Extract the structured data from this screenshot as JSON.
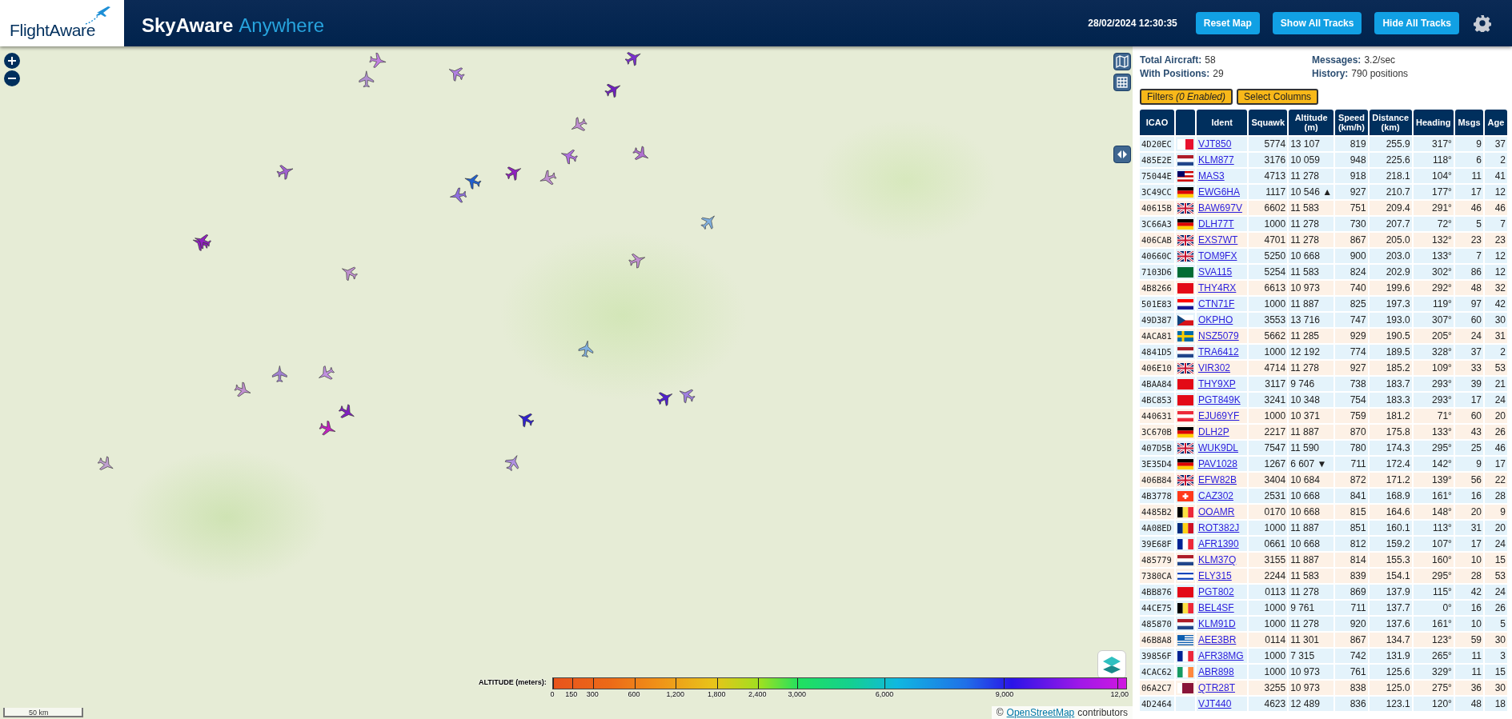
{
  "header": {
    "logo": "FlightAware",
    "title": "SkyAware",
    "subtitle": "Anywhere",
    "datetime": "28/02/2024 12:30:35",
    "buttons": [
      "Reset Map",
      "Show All Tracks",
      "Hide All Tracks"
    ]
  },
  "map": {
    "scale": "50 km",
    "attribution_prefix": "©",
    "attribution_link": "OpenStreetMap",
    "attribution_suffix": "contributors",
    "legend": {
      "title": "ALTITUDE (meters):",
      "ticks": [
        "0",
        "150",
        "300",
        "600",
        "1,200",
        "1,800",
        "2,400",
        "3,000",
        "6,000",
        "9,000",
        "12,00"
      ]
    }
  },
  "stats": [
    {
      "label": "Total Aircraft:",
      "value": "58"
    },
    {
      "label": "Messages:",
      "value": "3.2/sec"
    },
    {
      "label": "With Positions:",
      "value": "29"
    },
    {
      "label": "History:",
      "value": "790 positions"
    }
  ],
  "sidebar_buttons": [
    "Filters *(0 Enabled)*",
    "Select Columns"
  ],
  "table": {
    "columns": [
      "ICAO",
      "",
      "Ident",
      "Squawk",
      "Altitude (m)",
      "Speed (km/h)",
      "Distance (km)",
      "Heading",
      "Msgs",
      "Age"
    ],
    "rows": [
      {
        "icao": "4D20EC",
        "kind": "mt",
        "ident": "VJT850",
        "squawk": "5774",
        "altitude": "13 107",
        "speed": "819",
        "distance": "255.9",
        "heading": "317°",
        "msgs": "9",
        "age": "37",
        "color": "#e4f3fb"
      },
      {
        "icao": "485E2E",
        "kind": "nl",
        "ident": "KLM877",
        "squawk": "3176",
        "altitude": "10 059",
        "speed": "948",
        "distance": "225.6",
        "heading": "118°",
        "msgs": "6",
        "age": "2",
        "color": "#e4f3fb"
      },
      {
        "icao": "75044E",
        "kind": "my",
        "ident": "MAS3",
        "squawk": "4713",
        "altitude": "11 278",
        "speed": "918",
        "distance": "218.1",
        "heading": "104°",
        "msgs": "11",
        "age": "41",
        "color": "#e4f3fb"
      },
      {
        "icao": "3C49CC",
        "kind": "de",
        "ident": "EWG6HA",
        "squawk": "1117",
        "altitude": "10 546 ▲",
        "speed": "927",
        "distance": "210.7",
        "heading": "177°",
        "msgs": "17",
        "age": "12",
        "color": "#e4f3fb"
      },
      {
        "icao": "40615B",
        "kind": "gb",
        "ident": "BAW697V",
        "squawk": "6602",
        "altitude": "11 583",
        "speed": "751",
        "distance": "209.4",
        "heading": "291°",
        "msgs": "46",
        "age": "46",
        "color": "#fdf1e6"
      },
      {
        "icao": "3C66A3",
        "kind": "de",
        "ident": "DLH77T",
        "squawk": "1000",
        "altitude": "11 278",
        "speed": "730",
        "distance": "207.7",
        "heading": "72°",
        "msgs": "5",
        "age": "7",
        "color": "#e4f3fb"
      },
      {
        "icao": "406CAB",
        "kind": "gb",
        "ident": "EXS7WT",
        "squawk": "4701",
        "altitude": "11 278",
        "speed": "867",
        "distance": "205.0",
        "heading": "132°",
        "msgs": "23",
        "age": "23",
        "color": "#fdf1e6"
      },
      {
        "icao": "40660C",
        "kind": "gb",
        "ident": "TOM9FX",
        "squawk": "5250",
        "altitude": "10 668",
        "speed": "900",
        "distance": "203.0",
        "heading": "133°",
        "msgs": "7",
        "age": "12",
        "color": "#e4f3fb"
      },
      {
        "icao": "7103D6",
        "kind": "sa",
        "ident": "SVA115",
        "squawk": "5254",
        "altitude": "11 583",
        "speed": "824",
        "distance": "202.9",
        "heading": "302°",
        "msgs": "86",
        "age": "12",
        "color": "#e4f3fb"
      },
      {
        "icao": "4B8266",
        "kind": "tr",
        "ident": "THY4RX",
        "squawk": "6613",
        "altitude": "10 973",
        "speed": "740",
        "distance": "199.6",
        "heading": "292°",
        "msgs": "48",
        "age": "32",
        "color": "#fdf1e6"
      },
      {
        "icao": "501E83",
        "kind": "hr",
        "ident": "CTN71F",
        "squawk": "1000",
        "altitude": "11 887",
        "speed": "825",
        "distance": "197.3",
        "heading": "119°",
        "msgs": "97",
        "age": "42",
        "color": "#e4f3fb"
      },
      {
        "icao": "49D387",
        "kind": "cz",
        "ident": "OKPHO",
        "squawk": "3553",
        "altitude": "13 716",
        "speed": "747",
        "distance": "193.0",
        "heading": "307°",
        "msgs": "60",
        "age": "30",
        "color": "#e4f3fb"
      },
      {
        "icao": "4ACA81",
        "kind": "se",
        "ident": "NSZ5079",
        "squawk": "5662",
        "altitude": "11 285",
        "speed": "929",
        "distance": "190.5",
        "heading": "205°",
        "msgs": "24",
        "age": "31",
        "color": "#fdf1e6"
      },
      {
        "icao": "4841D5",
        "kind": "nl",
        "ident": "TRA6412",
        "squawk": "1000",
        "altitude": "12 192",
        "speed": "774",
        "distance": "189.5",
        "heading": "328°",
        "msgs": "37",
        "age": "2",
        "color": "#e4f3fb"
      },
      {
        "icao": "406E10",
        "kind": "gb",
        "ident": "VIR302",
        "squawk": "4714",
        "altitude": "11 278",
        "speed": "927",
        "distance": "185.2",
        "heading": "109°",
        "msgs": "33",
        "age": "53",
        "color": "#fdf1e6"
      },
      {
        "icao": "4BAA84",
        "kind": "tr",
        "ident": "THY9XP",
        "squawk": "3117",
        "altitude": "9 746",
        "speed": "738",
        "distance": "183.7",
        "heading": "293°",
        "msgs": "39",
        "age": "21",
        "color": "#e4f3fb"
      },
      {
        "icao": "4BC853",
        "kind": "tr",
        "ident": "PGT849K",
        "squawk": "3241",
        "altitude": "10 348",
        "speed": "754",
        "distance": "183.3",
        "heading": "293°",
        "msgs": "17",
        "age": "24",
        "color": "#e4f3fb"
      },
      {
        "icao": "440631",
        "kind": "at",
        "ident": "EJU69YF",
        "squawk": "1000",
        "altitude": "10 371",
        "speed": "759",
        "distance": "181.2",
        "heading": "71°",
        "msgs": "60",
        "age": "20",
        "color": "#fdf1e6"
      },
      {
        "icao": "3C670B",
        "kind": "de",
        "ident": "DLH2P",
        "squawk": "2217",
        "altitude": "11 887",
        "speed": "870",
        "distance": "175.8",
        "heading": "133°",
        "msgs": "43",
        "age": "26",
        "color": "#fdf1e6"
      },
      {
        "icao": "407D5B",
        "kind": "gb",
        "ident": "WUK9DL",
        "squawk": "7547",
        "altitude": "11 590",
        "speed": "780",
        "distance": "174.3",
        "heading": "295°",
        "msgs": "25",
        "age": "46",
        "color": "#e4f3fb"
      },
      {
        "icao": "3E35D4",
        "kind": "de",
        "ident": "PAV1028",
        "squawk": "1267",
        "altitude": "6 607 ▼",
        "speed": "711",
        "distance": "172.4",
        "heading": "142°",
        "msgs": "9",
        "age": "17",
        "color": "#e4f3fb"
      },
      {
        "icao": "406B84",
        "kind": "gb",
        "ident": "EFW82B",
        "squawk": "3404",
        "altitude": "10 684",
        "speed": "872",
        "distance": "171.2",
        "heading": "139°",
        "msgs": "56",
        "age": "22",
        "color": "#fdf1e6"
      },
      {
        "icao": "4B3778",
        "kind": "ch",
        "ident": "CAZ302",
        "squawk": "2531",
        "altitude": "10 668",
        "speed": "841",
        "distance": "168.9",
        "heading": "161°",
        "msgs": "16",
        "age": "28",
        "color": "#e4f3fb"
      },
      {
        "icao": "4485B2",
        "kind": "be",
        "ident": "OOAMR",
        "squawk": "0170",
        "altitude": "10 668",
        "speed": "815",
        "distance": "164.6",
        "heading": "148°",
        "msgs": "20",
        "age": "9",
        "color": "#fdf1e6"
      },
      {
        "icao": "4A08ED",
        "kind": "ro",
        "ident": "ROT382J",
        "squawk": "1000",
        "altitude": "11 887",
        "speed": "851",
        "distance": "160.1",
        "heading": "113°",
        "msgs": "31",
        "age": "20",
        "color": "#e4f3fb"
      },
      {
        "icao": "39E68F",
        "kind": "fr",
        "ident": "AFR1390",
        "squawk": "0661",
        "altitude": "10 668",
        "speed": "812",
        "distance": "159.2",
        "heading": "107°",
        "msgs": "17",
        "age": "24",
        "color": "#e4f3fb"
      },
      {
        "icao": "485779",
        "kind": "nl",
        "ident": "KLM37Q",
        "squawk": "3155",
        "altitude": "11 887",
        "speed": "814",
        "distance": "155.3",
        "heading": "160°",
        "msgs": "10",
        "age": "15",
        "color": "#fdf1e6"
      },
      {
        "icao": "7380CA",
        "kind": "il",
        "ident": "ELY315",
        "squawk": "2244",
        "altitude": "11 583",
        "speed": "839",
        "distance": "154.1",
        "heading": "295°",
        "msgs": "28",
        "age": "53",
        "color": "#fdf1e6"
      },
      {
        "icao": "4BB876",
        "kind": "tr",
        "ident": "PGT802",
        "squawk": "0113",
        "altitude": "11 278",
        "speed": "869",
        "distance": "137.9",
        "heading": "115°",
        "msgs": "42",
        "age": "24",
        "color": "#e4f3fb"
      },
      {
        "icao": "44CE75",
        "kind": "be",
        "ident": "BEL4SF",
        "squawk": "1000",
        "altitude": "9 761",
        "speed": "711",
        "distance": "137.7",
        "heading": "0°",
        "msgs": "16",
        "age": "26",
        "color": "#e4f3fb"
      },
      {
        "icao": "485870",
        "kind": "nl",
        "ident": "KLM91D",
        "squawk": "1000",
        "altitude": "11 278",
        "speed": "920",
        "distance": "137.6",
        "heading": "161°",
        "msgs": "10",
        "age": "5",
        "color": "#e4f3fb"
      },
      {
        "icao": "46B8A8",
        "kind": "gr",
        "ident": "AEE3BR",
        "squawk": "0114",
        "altitude": "11 301",
        "speed": "867",
        "distance": "134.7",
        "heading": "123°",
        "msgs": "59",
        "age": "30",
        "color": "#fdf1e6"
      },
      {
        "icao": "39856F",
        "kind": "fr",
        "ident": "AFR38MG",
        "squawk": "1000",
        "altitude": "7 315",
        "speed": "742",
        "distance": "131.9",
        "heading": "265°",
        "msgs": "11",
        "age": "3",
        "color": "#e4f3fb"
      },
      {
        "icao": "4CAC62",
        "kind": "ie",
        "ident": "ABR898",
        "squawk": "1000",
        "altitude": "10 973",
        "speed": "761",
        "distance": "125.6",
        "heading": "329°",
        "msgs": "11",
        "age": "15",
        "color": "#e4f3fb"
      },
      {
        "icao": "06A2C7",
        "kind": "qa",
        "ident": "QTR28T",
        "squawk": "3255",
        "altitude": "10 973",
        "speed": "838",
        "distance": "125.0",
        "heading": "275°",
        "msgs": "36",
        "age": "30",
        "color": "#fdf1e6"
      },
      {
        "icao": "4D2464",
        "ident": "VJT440",
        "squawk": "4623",
        "altitude": "12 489",
        "speed": "836",
        "distance": "123.1",
        "heading": "120°",
        "msgs": "48",
        "age": "18",
        "color": "#e4f3fb"
      }
    ]
  }
}
